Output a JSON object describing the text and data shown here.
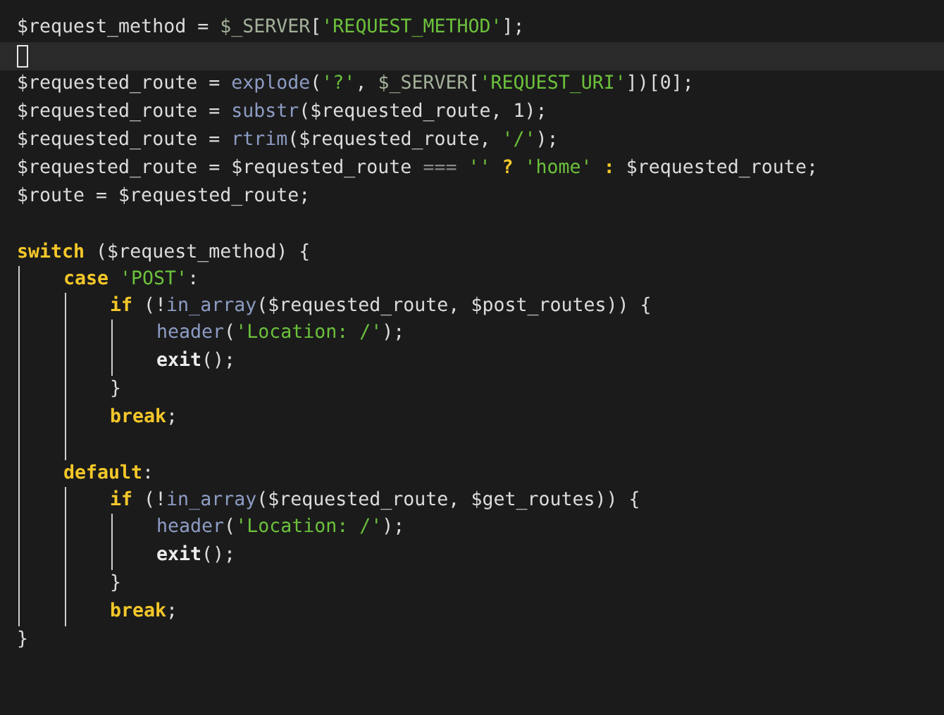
{
  "editor": {
    "lines": [
      {
        "kind": "code",
        "tokens": [
          {
            "text": "$request_method = ",
            "kind": "plain"
          },
          {
            "text": "$_SERVER",
            "kind": "builtin"
          },
          {
            "text": "[",
            "kind": "plain"
          },
          {
            "text": "'REQUEST_METHOD'",
            "kind": "string"
          },
          {
            "text": "];",
            "kind": "plain"
          }
        ]
      },
      {
        "kind": "cursor"
      },
      {
        "kind": "code",
        "tokens": [
          {
            "text": "$requested_route = ",
            "kind": "plain"
          },
          {
            "text": "explode",
            "kind": "func"
          },
          {
            "text": "(",
            "kind": "plain"
          },
          {
            "text": "'?'",
            "kind": "string"
          },
          {
            "text": ", ",
            "kind": "plain"
          },
          {
            "text": "$_SERVER",
            "kind": "builtin"
          },
          {
            "text": "[",
            "kind": "plain"
          },
          {
            "text": "'REQUEST_URI'",
            "kind": "string"
          },
          {
            "text": "])[0];",
            "kind": "plain"
          }
        ]
      },
      {
        "kind": "code",
        "tokens": [
          {
            "text": "$requested_route = ",
            "kind": "plain"
          },
          {
            "text": "substr",
            "kind": "func"
          },
          {
            "text": "($requested_route, 1);",
            "kind": "plain"
          }
        ]
      },
      {
        "kind": "code",
        "tokens": [
          {
            "text": "$requested_route = ",
            "kind": "plain"
          },
          {
            "text": "rtrim",
            "kind": "func"
          },
          {
            "text": "($requested_route, ",
            "kind": "plain"
          },
          {
            "text": "'/'",
            "kind": "string"
          },
          {
            "text": ");",
            "kind": "plain"
          }
        ]
      },
      {
        "kind": "code",
        "tokens": [
          {
            "text": "$requested_route = $requested_route ",
            "kind": "plain"
          },
          {
            "text": "=== ",
            "kind": "op"
          },
          {
            "text": "''",
            "kind": "string"
          },
          {
            "text": " ? ",
            "kind": "keyword"
          },
          {
            "text": "'home'",
            "kind": "string"
          },
          {
            "text": " : ",
            "kind": "keyword"
          },
          {
            "text": "$requested_route;",
            "kind": "plain"
          }
        ]
      },
      {
        "kind": "code",
        "tokens": [
          {
            "text": "$route = $requested_route;",
            "kind": "plain"
          }
        ]
      },
      {
        "kind": "blank"
      },
      {
        "kind": "code",
        "tokens": [
          {
            "text": "switch",
            "kind": "keyword"
          },
          {
            "text": " ($request_method) {",
            "kind": "plain"
          }
        ],
        "children": [
          {
            "kind": "code",
            "tokens": [
              {
                "text": "case ",
                "kind": "keyword"
              },
              {
                "text": "'POST'",
                "kind": "string"
              },
              {
                "text": ":",
                "kind": "plain"
              }
            ],
            "children": [
              {
                "kind": "code",
                "tokens": [
                  {
                    "text": "if",
                    "kind": "keyword"
                  },
                  {
                    "text": " (!",
                    "kind": "plain"
                  },
                  {
                    "text": "in_array",
                    "kind": "func"
                  },
                  {
                    "text": "($requested_route, $post_routes)) {",
                    "kind": "plain"
                  }
                ],
                "children": [
                  {
                    "kind": "code",
                    "tokens": [
                      {
                        "text": "header",
                        "kind": "func"
                      },
                      {
                        "text": "(",
                        "kind": "plain"
                      },
                      {
                        "text": "'Location: /'",
                        "kind": "string"
                      },
                      {
                        "text": ");",
                        "kind": "plain"
                      }
                    ]
                  },
                  {
                    "kind": "code",
                    "tokens": [
                      {
                        "text": "exit",
                        "kind": "strong"
                      },
                      {
                        "text": "();",
                        "kind": "plain"
                      }
                    ]
                  }
                ]
              },
              {
                "kind": "code",
                "tokens": [
                  {
                    "text": "}",
                    "kind": "plain"
                  }
                ]
              },
              {
                "kind": "code",
                "tokens": [
                  {
                    "text": "break",
                    "kind": "keyword"
                  },
                  {
                    "text": ";",
                    "kind": "plain"
                  }
                ]
              },
              {
                "kind": "blank"
              }
            ]
          },
          {
            "kind": "code",
            "tokens": [
              {
                "text": "default",
                "kind": "keyword"
              },
              {
                "text": ":",
                "kind": "plain"
              }
            ],
            "children": [
              {
                "kind": "code",
                "tokens": [
                  {
                    "text": "if",
                    "kind": "keyword"
                  },
                  {
                    "text": " (!",
                    "kind": "plain"
                  },
                  {
                    "text": "in_array",
                    "kind": "func"
                  },
                  {
                    "text": "($requested_route, $get_routes)) {",
                    "kind": "plain"
                  }
                ],
                "children": [
                  {
                    "kind": "code",
                    "tokens": [
                      {
                        "text": "header",
                        "kind": "func"
                      },
                      {
                        "text": "(",
                        "kind": "plain"
                      },
                      {
                        "text": "'Location: /'",
                        "kind": "string"
                      },
                      {
                        "text": ");",
                        "kind": "plain"
                      }
                    ]
                  },
                  {
                    "kind": "code",
                    "tokens": [
                      {
                        "text": "exit",
                        "kind": "strong"
                      },
                      {
                        "text": "();",
                        "kind": "plain"
                      }
                    ]
                  }
                ]
              },
              {
                "kind": "code",
                "tokens": [
                  {
                    "text": "}",
                    "kind": "plain"
                  }
                ]
              },
              {
                "kind": "code",
                "tokens": [
                  {
                    "text": "break",
                    "kind": "keyword"
                  },
                  {
                    "text": ";",
                    "kind": "plain"
                  }
                ]
              }
            ]
          }
        ]
      },
      {
        "kind": "code",
        "tokens": [
          {
            "text": "}",
            "kind": "plain"
          }
        ]
      }
    ]
  }
}
